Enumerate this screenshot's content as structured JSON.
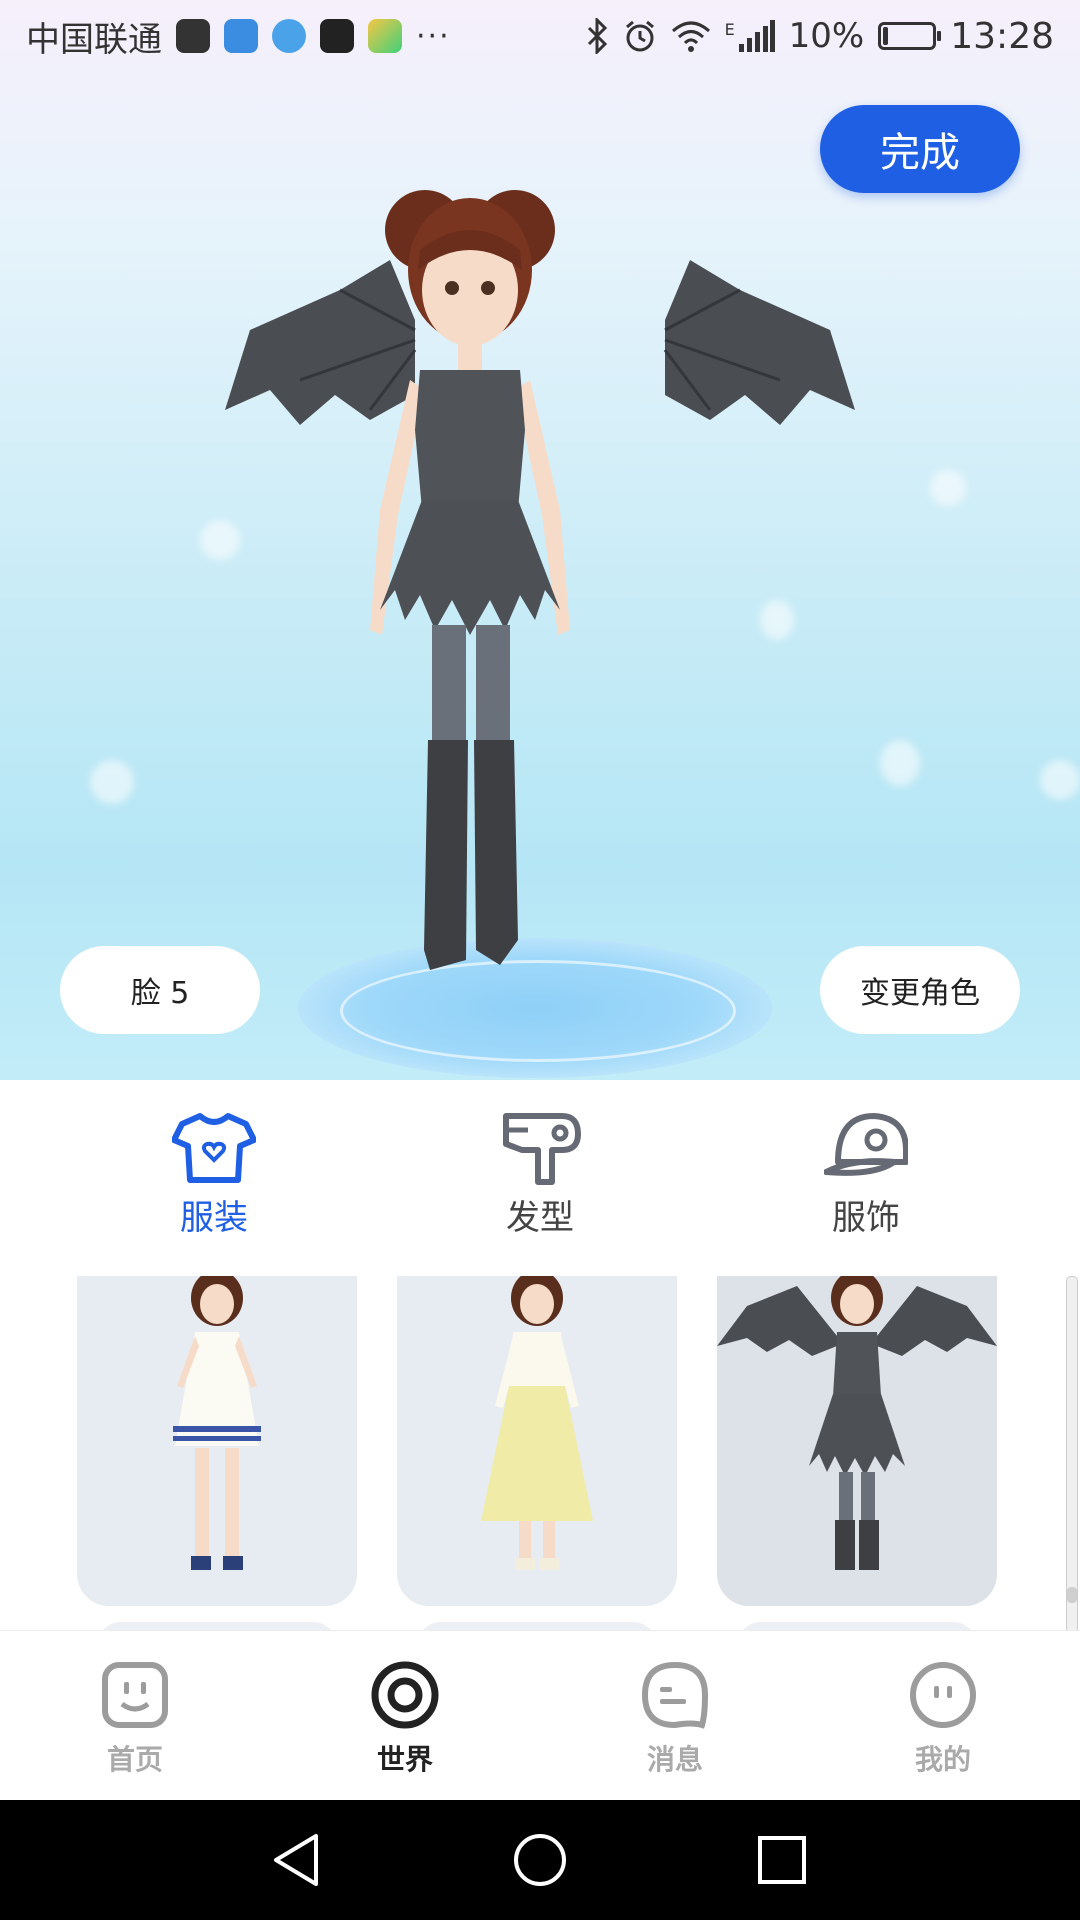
{
  "status_bar": {
    "carrier": "中国联通",
    "more": "···",
    "network": "E",
    "battery_percent": "10%",
    "battery_level": 0.1,
    "time": "13:28"
  },
  "stage": {
    "done_label": "完成",
    "face_label": "脸 5",
    "change_role_label": "变更角色"
  },
  "tabs": [
    {
      "label": "服装",
      "icon": "tshirt-heart-icon",
      "active": true
    },
    {
      "label": "发型",
      "icon": "hair-dryer-icon",
      "active": false
    },
    {
      "label": "服饰",
      "icon": "cap-icon",
      "active": false
    }
  ],
  "outfits": [
    {
      "name": "white-sailor-dress",
      "selected": false
    },
    {
      "name": "yellow-skirt-outfit",
      "selected": false
    },
    {
      "name": "bat-wing-dress",
      "selected": true
    }
  ],
  "bottom_nav": [
    {
      "label": "首页",
      "icon": "home-face-icon",
      "active": false
    },
    {
      "label": "世界",
      "icon": "world-target-icon",
      "active": true
    },
    {
      "label": "消息",
      "icon": "message-bubble-icon",
      "active": false
    },
    {
      "label": "我的",
      "icon": "profile-face-icon",
      "active": false
    }
  ],
  "colors": {
    "accent": "#1f5fe3",
    "nav_active": "#222222",
    "nav_inactive": "#aaaaaa",
    "card_bg": "#e7ebf2"
  }
}
